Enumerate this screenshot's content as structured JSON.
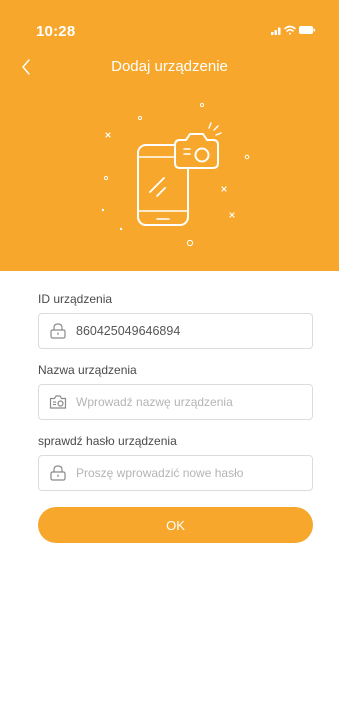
{
  "status_bar": {
    "time": "10:28"
  },
  "nav": {
    "title": "Dodaj urządzenie"
  },
  "form": {
    "device_id": {
      "label": "ID urządzenia",
      "value": "860425049646894",
      "icon": "lock-icon"
    },
    "device_name": {
      "label": "Nazwa urządzenia",
      "placeholder": "Wprowadź nazwę urządzenia",
      "icon": "camera-icon"
    },
    "device_password": {
      "label": "sprawdź hasło urządzenia",
      "placeholder": "Proszę wprowadzić nowe hasło",
      "icon": "lock-icon"
    }
  },
  "actions": {
    "ok_label": "OK"
  },
  "colors": {
    "accent": "#f7a82c",
    "border": "#dcdcdc",
    "placeholder": "#b4b4b4"
  }
}
